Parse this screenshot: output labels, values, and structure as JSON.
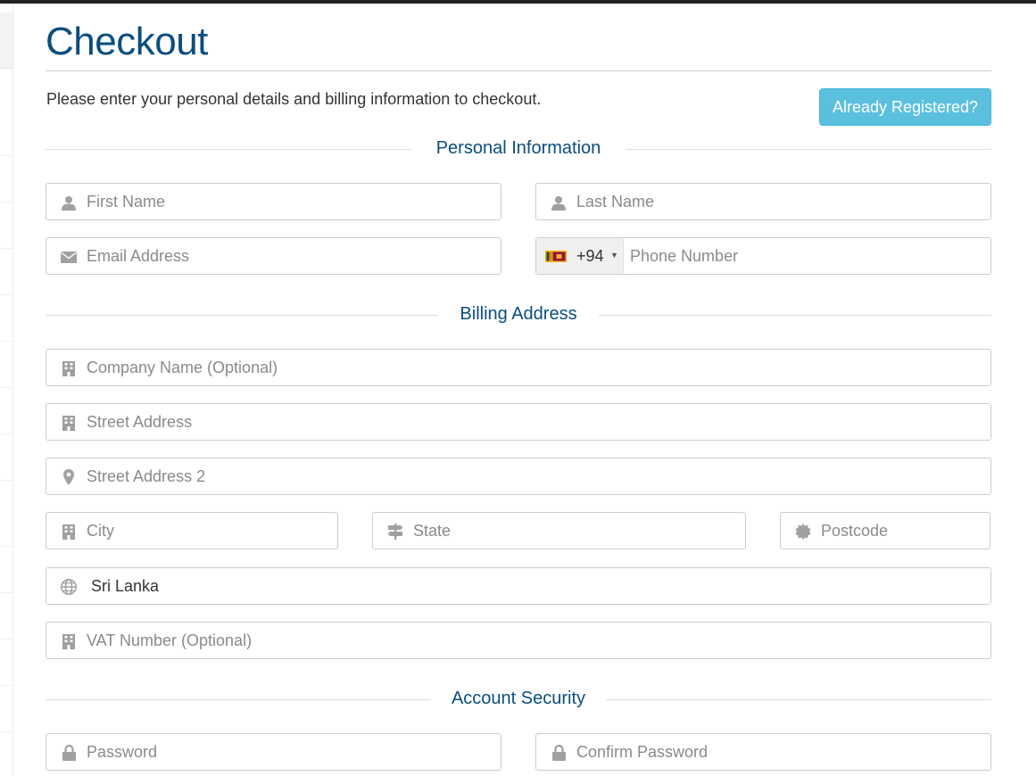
{
  "page": {
    "title": "Checkout",
    "intro": "Please enter your personal details and billing information to checkout.",
    "already_registered_label": "Already Registered?"
  },
  "sections": {
    "personal": "Personal Information",
    "billing": "Billing Address",
    "security": "Account Security"
  },
  "fields": {
    "first_name": {
      "placeholder": "First Name",
      "icon": "user-icon"
    },
    "last_name": {
      "placeholder": "Last Name",
      "icon": "user-icon"
    },
    "email": {
      "placeholder": "Email Address",
      "icon": "envelope-icon"
    },
    "phone": {
      "placeholder": "Phone Number",
      "country_code": "+94",
      "flag": "sri-lanka-flag-icon"
    },
    "company": {
      "placeholder": "Company Name (Optional)",
      "icon": "building-icon"
    },
    "street1": {
      "placeholder": "Street Address",
      "icon": "building-icon"
    },
    "street2": {
      "placeholder": "Street Address 2",
      "icon": "map-marker-icon"
    },
    "city": {
      "placeholder": "City",
      "icon": "building-icon"
    },
    "state": {
      "placeholder": "State",
      "icon": "signpost-icon"
    },
    "postcode": {
      "placeholder": "Postcode",
      "icon": "certificate-icon"
    },
    "country": {
      "value": "Sri Lanka",
      "icon": "globe-icon"
    },
    "vat": {
      "placeholder": "VAT Number (Optional)",
      "icon": "building-icon"
    },
    "password": {
      "placeholder": "Password",
      "icon": "lock-icon"
    },
    "confirm_password": {
      "placeholder": "Confirm Password",
      "icon": "lock-icon"
    }
  },
  "colors": {
    "heading": "#0b4d7d",
    "info_button": "#5bc0de",
    "icon": "#a0a0a0",
    "field_border": "#cccccc"
  }
}
